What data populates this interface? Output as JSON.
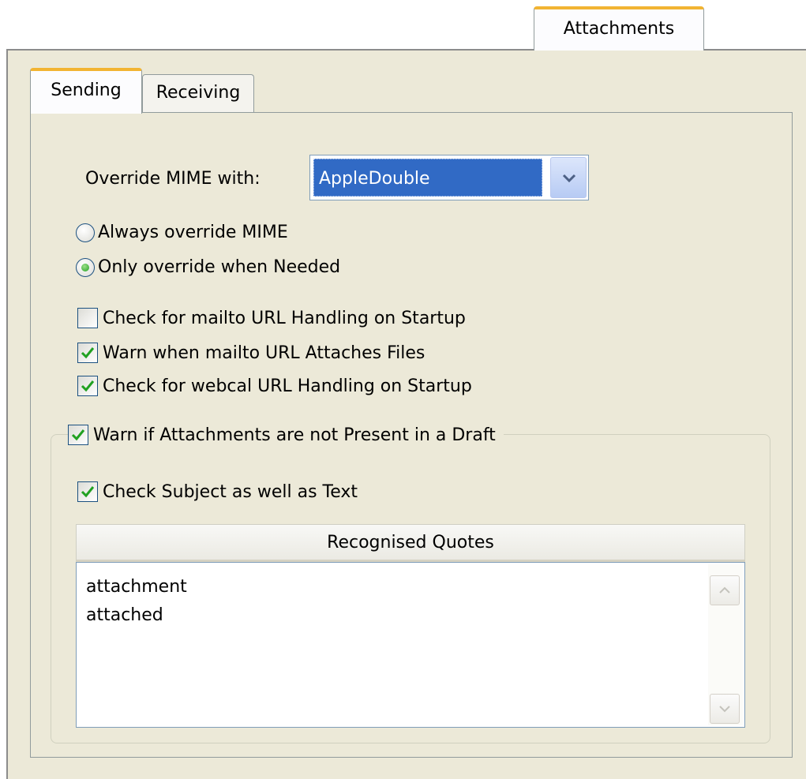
{
  "outer_tab": {
    "label": "Attachments"
  },
  "inner_tabs": [
    {
      "label": "Sending",
      "active": true
    },
    {
      "label": "Receiving",
      "active": false
    }
  ],
  "override_mime": {
    "label": "Override MIME with:",
    "selected": "AppleDouble"
  },
  "radios": [
    {
      "label": "Always override MIME",
      "checked": false
    },
    {
      "label": "Only override when Needed",
      "checked": true
    }
  ],
  "checkboxes": [
    {
      "label": "Check for mailto URL Handling on Startup",
      "checked": false
    },
    {
      "label": "Warn when mailto URL Attaches Files",
      "checked": true
    },
    {
      "label": "Check for webcal URL Handling on Startup",
      "checked": true
    }
  ],
  "draft_group": {
    "label": "Warn if Attachments are not Present in a Draft",
    "checked": true,
    "check_subject": {
      "label": "Check Subject as well as Text",
      "checked": true
    },
    "quotes_header": "Recognised Quotes",
    "quotes": [
      "attachment",
      "attached"
    ]
  },
  "colors": {
    "panel": "#ece9d8",
    "tab_accent": "#f2b432",
    "selection": "#316ac5",
    "check_green": "#21a121"
  }
}
